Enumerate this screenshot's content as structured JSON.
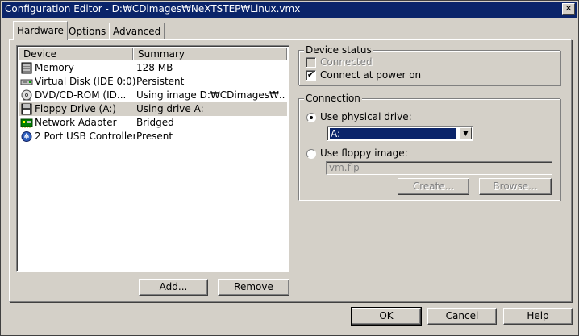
{
  "window": {
    "title": "Configuration Editor - D:₩CDimages₩NeXTSTEP₩Linux.vmx",
    "close_glyph": "✕"
  },
  "tabs": [
    {
      "label": "Hardware",
      "active": true
    },
    {
      "label": "Options",
      "active": false
    },
    {
      "label": "Advanced",
      "active": false
    }
  ],
  "devices": {
    "columns": [
      "Device",
      "Summary"
    ],
    "rows": [
      {
        "icon": "memory-icon",
        "device": "Memory",
        "summary": "128 MB",
        "selected": false
      },
      {
        "icon": "hard-disk-icon",
        "device": "Virtual Disk (IDE 0:0)",
        "summary": "Persistent",
        "selected": false
      },
      {
        "icon": "cdrom-icon",
        "device": "DVD/CD-ROM (ID...",
        "summary": "Using image D:₩CDimages₩...",
        "selected": false
      },
      {
        "icon": "floppy-icon",
        "device": "Floppy Drive (A:)",
        "summary": "Using drive A:",
        "selected": true
      },
      {
        "icon": "network-adapter-icon",
        "device": "Network Adapter",
        "summary": "Bridged",
        "selected": false
      },
      {
        "icon": "usb-icon",
        "device": "2 Port USB Controller",
        "summary": "Present",
        "selected": false
      }
    ]
  },
  "buttons": {
    "add": "Add...",
    "remove": "Remove",
    "ok": "OK",
    "cancel": "Cancel",
    "help": "Help",
    "create": "Create...",
    "browse": "Browse..."
  },
  "device_status": {
    "title": "Device status",
    "connected_label": "Connected",
    "connected_checked": false,
    "connected_enabled": false,
    "power_on_label": "Connect at power on",
    "power_on_checked": true,
    "check_glyph": "✔"
  },
  "connection": {
    "title": "Connection",
    "use_physical_label": "Use physical drive:",
    "use_physical_selected": true,
    "physical_drive_value": "A:",
    "dropdown_arrow": "▼",
    "use_floppy_image_label": "Use floppy image:",
    "use_floppy_image_selected": false,
    "floppy_image_value": "vm.flp"
  },
  "colors": {
    "titlebar": "#0a246a",
    "face": "#d4d0c8",
    "selection": "#0a246a"
  }
}
